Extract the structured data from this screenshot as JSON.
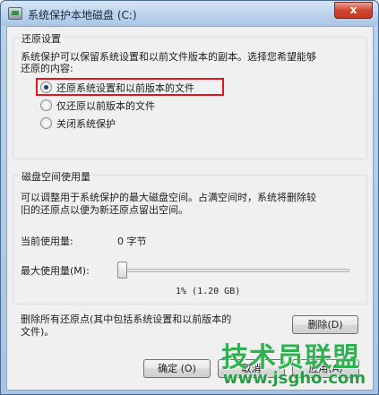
{
  "window": {
    "title": "系统保护本地磁盘 (C:)",
    "close_label": "x"
  },
  "restore_settings": {
    "group_title": "还原设置",
    "description_line1": "系统保护可以保留系统设置和以前文件版本的副本。选择您希望能够",
    "description_line2": "还原的内容:",
    "options": [
      {
        "label": "还原系统设置和以前版本的文件",
        "checked": true
      },
      {
        "label": "仅还原以前版本的文件",
        "checked": false
      },
      {
        "label": "关闭系统保护",
        "checked": false
      }
    ]
  },
  "disk_usage": {
    "group_title": "磁盘空间使用量",
    "description_line1": "可以调整用于系统保护的最大磁盘空间。占满空间时，系统将删除较",
    "description_line2": "旧的还原点以便为新还原点留出空间。",
    "current_usage_label": "当前使用量:",
    "current_usage_value": "0 字节",
    "max_usage_label": "最大使用量(M):",
    "max_usage_fraction": 0.01,
    "max_usage_readout": "1% (1.20 GB)"
  },
  "delete_section": {
    "text_line1": "删除所有还原点(其中包括系统设置和以前版本的",
    "text_line2": "文件)。",
    "delete_label": "删除(D)"
  },
  "footer": {
    "ok_label": "确定 (O)",
    "cancel_label": "取消",
    "apply_label": "应用(A)"
  },
  "watermark": {
    "brand": "技术员联盟",
    "url": "www.jsgho.com"
  },
  "colors": {
    "highlight": "#e0161f",
    "watermark": "#2fb350"
  }
}
